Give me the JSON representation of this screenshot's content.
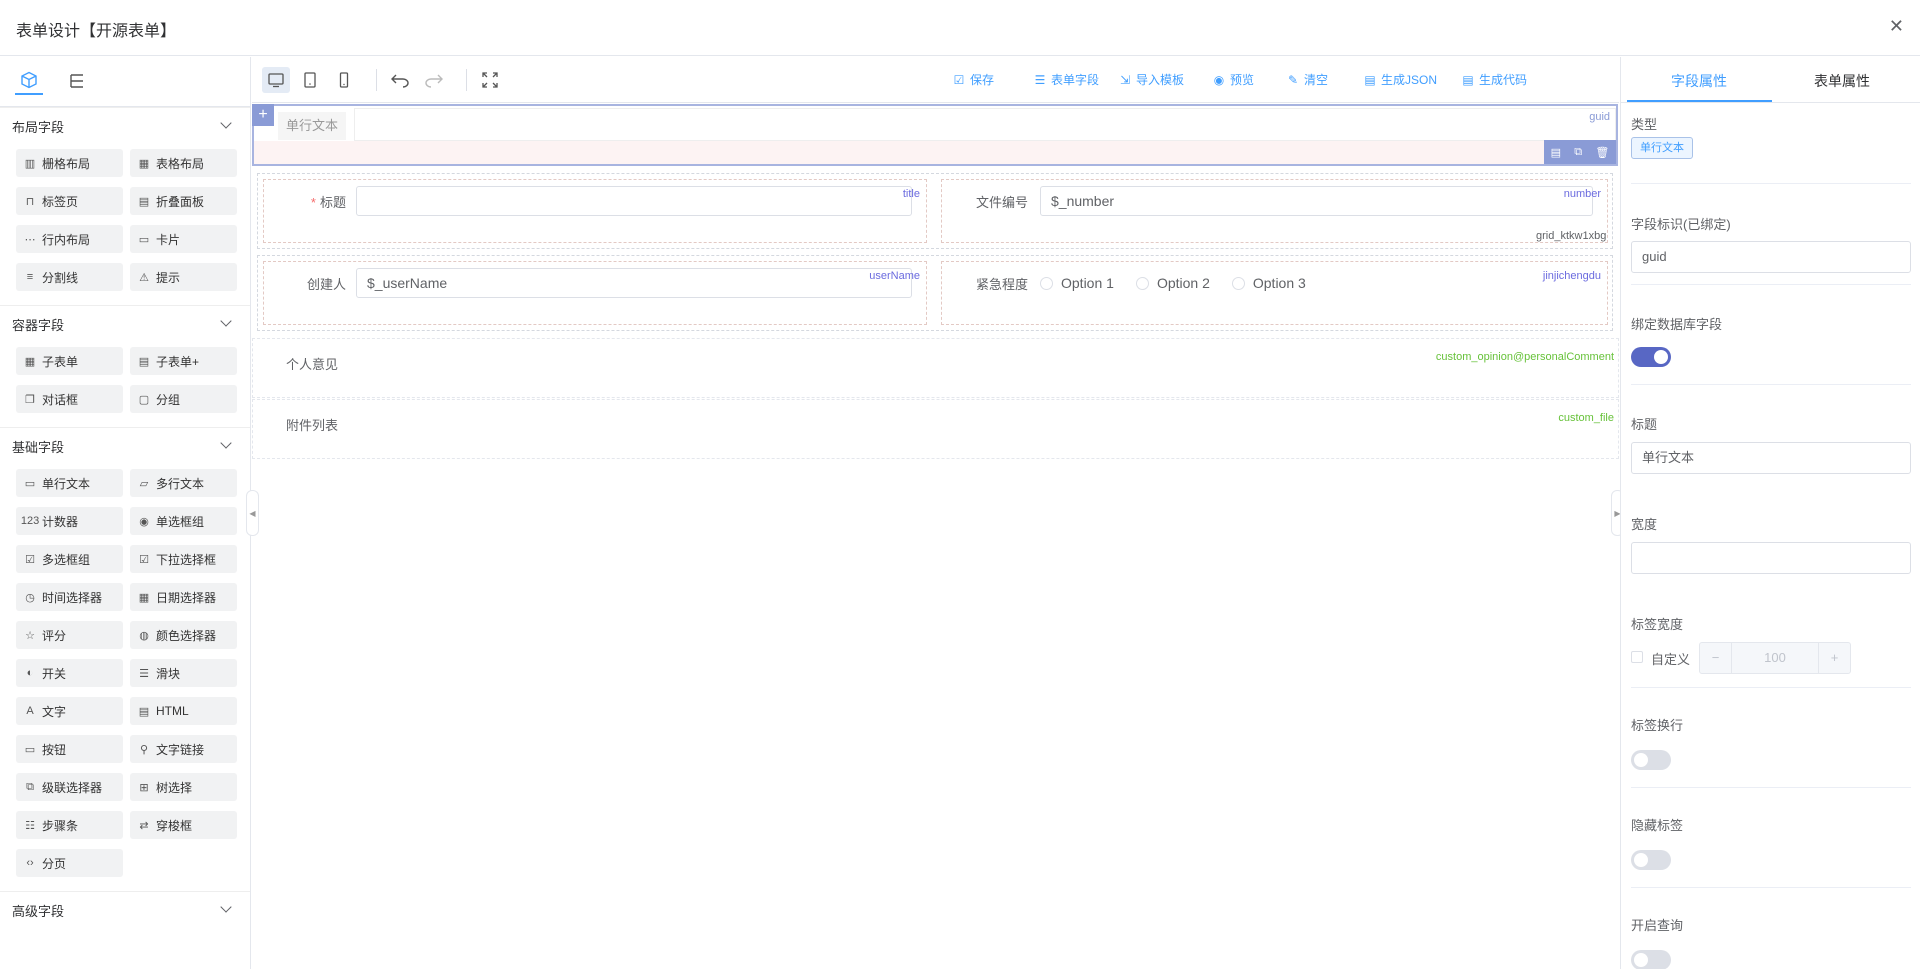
{
  "title": "表单设计【开源表单】",
  "left": {
    "sections": [
      {
        "label": "布局字段",
        "items": [
          {
            "label": "栅格布局",
            "icon": "grid-layout-icon"
          },
          {
            "label": "表格布局",
            "icon": "table-layout-icon"
          },
          {
            "label": "标签页",
            "icon": "tabs-icon"
          },
          {
            "label": "折叠面板",
            "icon": "collapse-icon"
          },
          {
            "label": "行内布局",
            "icon": "inline-layout-icon"
          },
          {
            "label": "卡片",
            "icon": "card-icon"
          },
          {
            "label": "分割线",
            "icon": "divider-icon"
          },
          {
            "label": "提示",
            "icon": "alert-icon"
          }
        ]
      },
      {
        "label": "容器字段",
        "items": [
          {
            "label": "子表单",
            "icon": "subform-icon"
          },
          {
            "label": "子表单+",
            "icon": "subform-plus-icon"
          },
          {
            "label": "对话框",
            "icon": "dialog-icon"
          },
          {
            "label": "分组",
            "icon": "group-icon"
          }
        ]
      },
      {
        "label": "基础字段",
        "items": [
          {
            "label": "单行文本",
            "icon": "input-icon"
          },
          {
            "label": "多行文本",
            "icon": "textarea-icon"
          },
          {
            "label": "计数器",
            "icon": "number-icon"
          },
          {
            "label": "单选框组",
            "icon": "radio-icon"
          },
          {
            "label": "多选框组",
            "icon": "checkbox-icon"
          },
          {
            "label": "下拉选择框",
            "icon": "select-icon"
          },
          {
            "label": "时间选择器",
            "icon": "clock-icon"
          },
          {
            "label": "日期选择器",
            "icon": "calendar-icon"
          },
          {
            "label": "评分",
            "icon": "star-icon"
          },
          {
            "label": "颜色选择器",
            "icon": "palette-icon"
          },
          {
            "label": "开关",
            "icon": "switch-icon"
          },
          {
            "label": "滑块",
            "icon": "slider-icon"
          },
          {
            "label": "文字",
            "icon": "text-icon"
          },
          {
            "label": "HTML",
            "icon": "html-icon"
          },
          {
            "label": "按钮",
            "icon": "button-icon"
          },
          {
            "label": "文字链接",
            "icon": "link-icon"
          },
          {
            "label": "级联选择器",
            "icon": "cascader-icon"
          },
          {
            "label": "树选择",
            "icon": "tree-icon"
          },
          {
            "label": "步骤条",
            "icon": "steps-icon"
          },
          {
            "label": "穿梭框",
            "icon": "transfer-icon"
          },
          {
            "label": "分页",
            "icon": "pagination-icon"
          }
        ]
      },
      {
        "label": "高级字段",
        "items": []
      }
    ]
  },
  "toolbar": {
    "buttons": [
      {
        "label": "保存",
        "icon": "check-square-icon"
      },
      {
        "label": "表单字段",
        "icon": "list-settings-icon"
      },
      {
        "label": "导入模板",
        "icon": "import-icon"
      },
      {
        "label": "预览",
        "icon": "eye-icon"
      },
      {
        "label": "清空",
        "icon": "brush-icon"
      },
      {
        "label": "生成JSON",
        "icon": "file-json-icon"
      },
      {
        "label": "生成代码",
        "icon": "file-code-icon"
      }
    ]
  },
  "canvas": {
    "selected": {
      "label": "单行文本",
      "tag": "guid"
    },
    "grid_tag": "grid_ktkw1xbg",
    "title_field": {
      "label": "标题",
      "tag": "title",
      "value": ""
    },
    "number_field": {
      "label": "文件编号",
      "tag": "number",
      "value": "$_number"
    },
    "creator_field": {
      "label": "创建人",
      "tag": "userName",
      "value": "$_userName"
    },
    "urgency_field": {
      "label": "紧急程度",
      "tag": "jinjichengdu",
      "options": [
        "Option 1",
        "Option 2",
        "Option 3"
      ]
    },
    "opinion": {
      "label": "个人意见",
      "tag": "custom_opinion@personalComment"
    },
    "files": {
      "label": "附件列表",
      "tag": "custom_file"
    }
  },
  "right": {
    "tabs": [
      "字段属性",
      "表单属性"
    ],
    "type_label": "类型",
    "type_value": "单行文本",
    "field_id_label": "字段标识(已绑定)",
    "field_id_value": "guid",
    "bind_db_label": "绑定数据库字段",
    "bind_db_on": true,
    "title_label": "标题",
    "title_value": "单行文本",
    "width_label": "宽度",
    "width_value": "",
    "label_width_label": "标签宽度",
    "custom_label": "自定义",
    "label_width_value": "100",
    "label_wrap_label": "标签换行",
    "hide_label_label": "隐藏标签",
    "query_label": "开启查询",
    "minus": "−",
    "plus": "+",
    "accent": "#409eff",
    "toggle_on": "#5867c4"
  }
}
